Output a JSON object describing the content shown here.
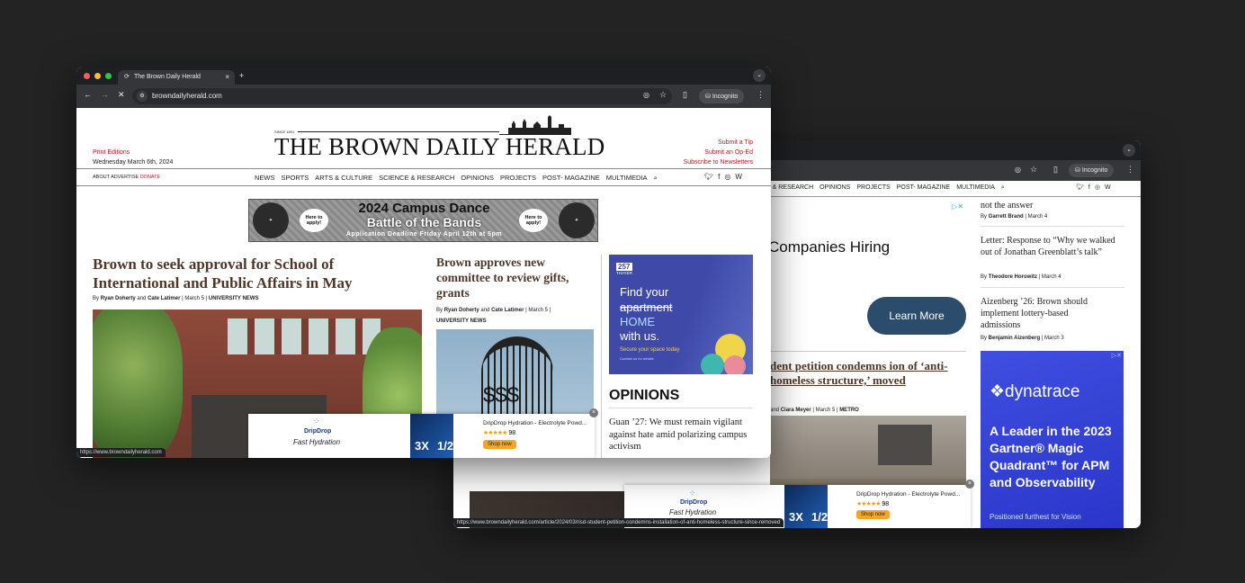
{
  "browser": {
    "tab_title": "The Brown Daily Herald",
    "url": "browndailyherald.com",
    "incognito": "Incognito",
    "status_url_front": "https://www.browndailyherald.com",
    "status_url_back": "https://www.browndailyherald.com/article/2024/03/risd-student-petition-condemns-installation-of-anti-homeless-structure-since-removed"
  },
  "header": {
    "since": "SINCE 1891",
    "masthead": "THE BROWN DAILY HERALD",
    "print_editions": "Print Editions",
    "date": "Wednesday March 6th, 2024",
    "submit_tip": "Submit a Tip",
    "submit_oped": "Submit an Op-Ed",
    "subscribe": "Subscribe to Newsletters",
    "about": "ABOUT",
    "advertise": "ADVERTISE",
    "donate": "DONATE"
  },
  "nav": [
    "NEWS",
    "SPORTS",
    "ARTS & CULTURE",
    "SCIENCE & RESEARCH",
    "OPINIONS",
    "PROJECTS",
    "POST- MAGAZINE",
    "MULTIMEDIA"
  ],
  "nav_back": [
    "E & RESEARCH",
    "OPINIONS",
    "PROJECTS",
    "POST- MAGAZINE",
    "MULTIMEDIA"
  ],
  "banner": {
    "line1": "2024 Campus Dance",
    "line2": "Battle of the Bands",
    "line3": "Application Deadline Friday April 12th at 5pm",
    "badge": "Here to apply!"
  },
  "lead": {
    "headline": "Brown to seek approval for School of International and Public Affairs in May",
    "by": "By",
    "a1": "Ryan Doherty",
    "and": "and",
    "a2": "Cate Latimer",
    "meta": "| March 5 |",
    "section": "UNIVERSITY NEWS"
  },
  "story2": {
    "headline": "Brown approves new committee to review gifts, grants",
    "a1": "Ryan Doherty",
    "a2": "Cate Latimer",
    "meta": "| March 5 |",
    "section": "UNIVERSITY NEWS"
  },
  "ad_thayer": {
    "brand": "257",
    "brand2": "THAYER",
    "l1": "Find your",
    "l2": "apartment",
    "l3": "HOME",
    "l4": "with us.",
    "cta": "Secure your space today",
    "small": "Contact us for details"
  },
  "opinions": {
    "title": "OPINIONS",
    "item1": "Guan ’27: We must remain vigilant against hate amid polarizing campus activism"
  },
  "ad_dripdrop": {
    "brand": "DripDrop",
    "tag": "Fast Hydration",
    "product": "DripDrop Hydration - Electrolyte Powd...",
    "rating": "98",
    "shop": "Shop now",
    "pack": "3X",
    "pack2": "1/2"
  },
  "back": {
    "top_text": "not the answer",
    "by1": "Garrett Brand",
    "meta1": "| March 4",
    "op2": "Letter: Response to “Why we walked out of Jonathan Greenblatt’s talk”",
    "by2": "Theodore Horowitz",
    "meta2": "| March 4",
    "op3": "Aizenberg ’26: Brown should implement lottery-based admissions",
    "by3": "Benjamin Aizenberg",
    "meta3": "| March 3",
    "ad_text": "Companies Hiring",
    "learn": "Learn More",
    "story_title": "dent petition condemns ion of ‘anti-homeless structure,’ moved",
    "story_by": "and",
    "story_author": "Ciara Meyer",
    "story_meta": "| March 5 |",
    "story_section": "METRO",
    "dyn_brand": "dynatrace",
    "dyn_body": "A Leader in the 2023 Gartner® Magic Quadrant™ for APM and Observability",
    "dyn_sub": "Positioned furthest for Vision"
  }
}
